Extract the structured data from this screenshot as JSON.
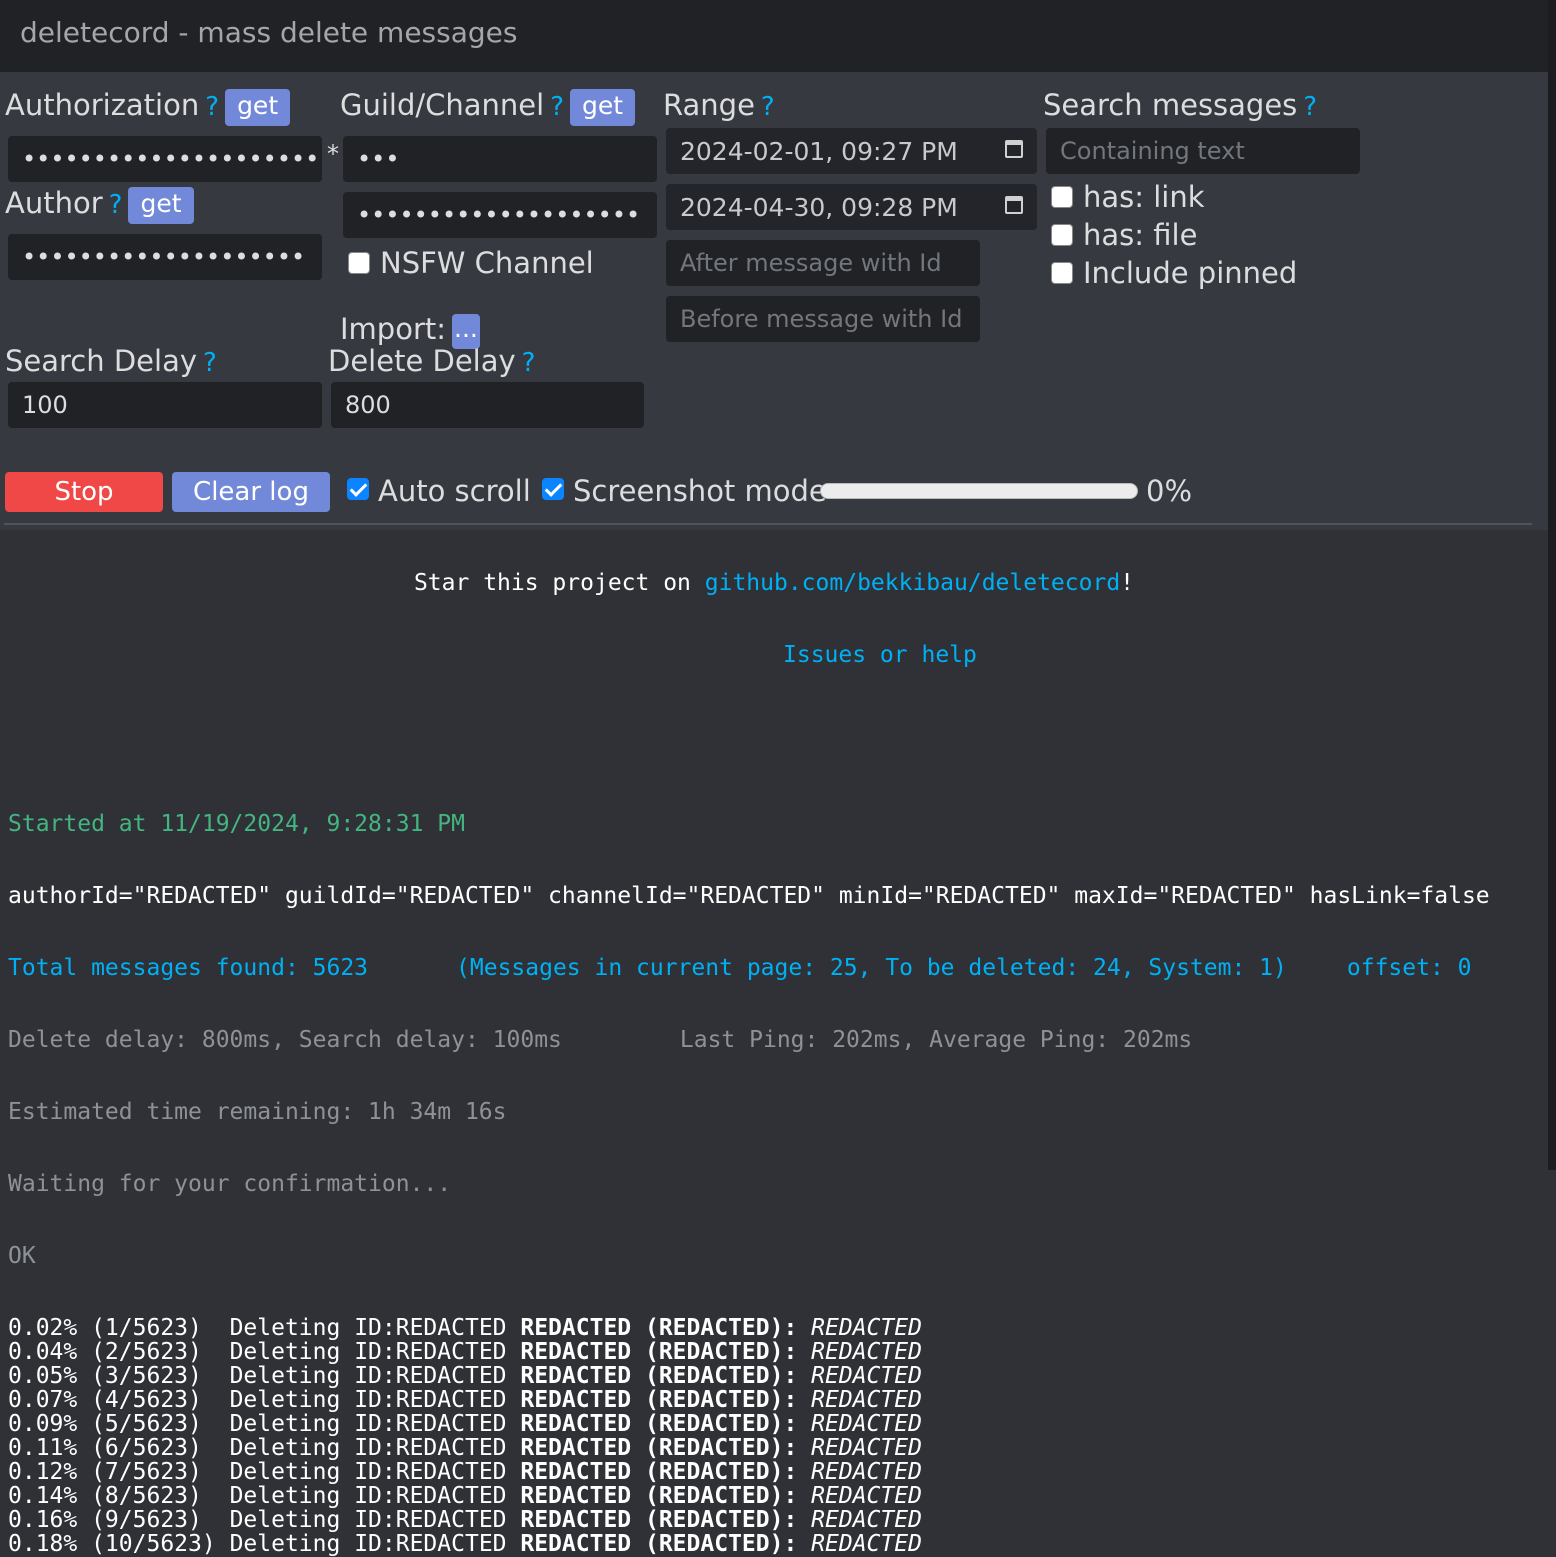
{
  "window": {
    "title": "deletecord - mass delete messages"
  },
  "auth": {
    "label": "Authorization",
    "help": "?",
    "get": "get",
    "value": "••••••••••••••••••••••••••••••••••••••••",
    "required": "*"
  },
  "guild": {
    "label": "Guild/Channel",
    "help": "?",
    "get": "get",
    "guild_value": "•••",
    "channel_value": "••••••••••••••••••••",
    "nsfw_label": "NSFW Channel",
    "import_label": "Import:",
    "import_button": "..."
  },
  "author": {
    "label": "Author",
    "help": "?",
    "get": "get",
    "value": "••••••••••••••••••••"
  },
  "range": {
    "label": "Range",
    "help": "?",
    "min_date": "2024-02-01, 09:27 PM",
    "max_date": "2024-04-30, 09:28 PM",
    "after_placeholder": "After message with Id",
    "before_placeholder": "Before message with Id"
  },
  "search": {
    "label": "Search messages",
    "help": "?",
    "placeholder": "Containing text",
    "has_link": "has: link",
    "has_file": "has: file",
    "include_pinned": "Include pinned"
  },
  "delays": {
    "search_label": "Search Delay",
    "search_help": "?",
    "search_value": "100",
    "delete_label": "Delete Delay",
    "delete_help": "?",
    "delete_value": "800"
  },
  "actions": {
    "stop": "Stop",
    "clear_log": "Clear log",
    "auto_scroll": "Auto scroll",
    "auto_scroll_checked": true,
    "screenshot_mode": "Screenshot mode",
    "screenshot_checked": true,
    "progress": 0,
    "progress_text": "0%"
  },
  "footer": {
    "star_prefix": "Star this project on ",
    "star_link": "github.com/bekkibau/deletecord",
    "star_suffix": "!",
    "issues": "Issues or help"
  },
  "log": {
    "started": "Started at 11/19/2024, 9:28:31 PM",
    "params": "authorId=\"REDACTED\" guildId=\"REDACTED\" channelId=\"REDACTED\" minId=\"REDACTED\" maxId=\"REDACTED\" hasLink=false",
    "total": "Total messages found: 5623",
    "page_info": "(Messages in current page: 25, To be deleted: 24, System: 1)",
    "offset": "offset: 0",
    "delays": "Delete delay: 800ms, Search delay: 100ms",
    "ping": "Last Ping: 202ms, Average Ping: 202ms",
    "remaining": "Estimated time remaining: 1h 34m 16s",
    "waiting": "Waiting for your confirmation...",
    "ok": "OK",
    "entries": [
      {
        "progress": "0.02% (1/5623) ",
        "action": " Deleting ID:REDACTED ",
        "who": "REDACTED (REDACTED):",
        "content": " REDACTED"
      },
      {
        "progress": "0.04% (2/5623) ",
        "action": " Deleting ID:REDACTED ",
        "who": "REDACTED (REDACTED):",
        "content": " REDACTED"
      },
      {
        "progress": "0.05% (3/5623) ",
        "action": " Deleting ID:REDACTED ",
        "who": "REDACTED (REDACTED):",
        "content": " REDACTED"
      },
      {
        "progress": "0.07% (4/5623) ",
        "action": " Deleting ID:REDACTED ",
        "who": "REDACTED (REDACTED):",
        "content": " REDACTED"
      },
      {
        "progress": "0.09% (5/5623) ",
        "action": " Deleting ID:REDACTED ",
        "who": "REDACTED (REDACTED):",
        "content": " REDACTED"
      },
      {
        "progress": "0.11% (6/5623) ",
        "action": " Deleting ID:REDACTED ",
        "who": "REDACTED (REDACTED):",
        "content": " REDACTED"
      },
      {
        "progress": "0.12% (7/5623) ",
        "action": " Deleting ID:REDACTED ",
        "who": "REDACTED (REDACTED):",
        "content": " REDACTED"
      },
      {
        "progress": "0.14% (8/5623) ",
        "action": " Deleting ID:REDACTED ",
        "who": "REDACTED (REDACTED):",
        "content": " REDACTED"
      },
      {
        "progress": "0.16% (9/5623) ",
        "action": " Deleting ID:REDACTED ",
        "who": "REDACTED (REDACTED):",
        "content": " REDACTED"
      },
      {
        "progress": "0.18% (10/5623)",
        "action": " Deleting ID:REDACTED ",
        "who": "REDACTED (REDACTED):",
        "content": " REDACTED"
      }
    ]
  }
}
